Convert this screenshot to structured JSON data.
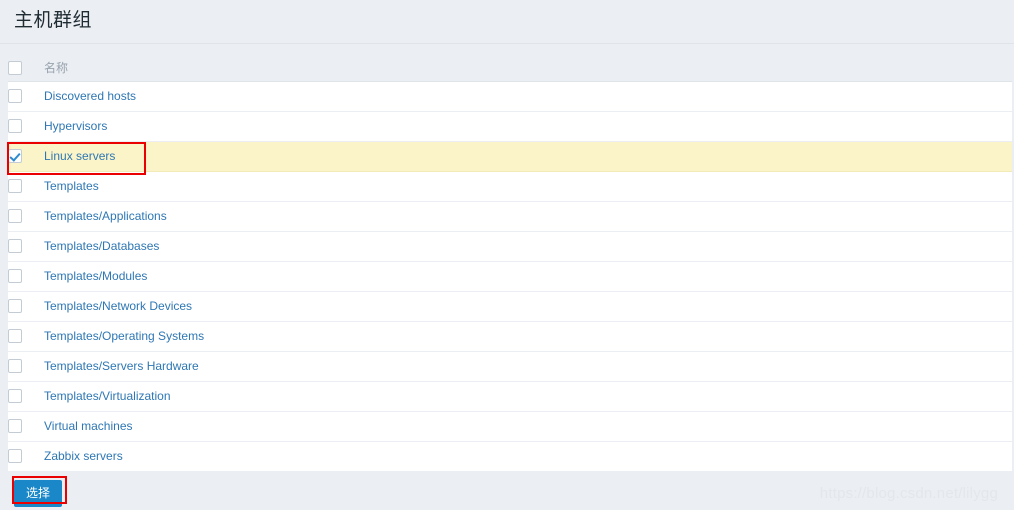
{
  "header": {
    "title": "主机群组"
  },
  "table": {
    "columns": [
      {
        "key": "checkbox",
        "label": ""
      },
      {
        "key": "name",
        "label": "名称"
      }
    ],
    "header_checkbox_checked": false,
    "rows": [
      {
        "name": "Discovered hosts",
        "checked": false
      },
      {
        "name": "Hypervisors",
        "checked": false
      },
      {
        "name": "Linux servers",
        "checked": true
      },
      {
        "name": "Templates",
        "checked": false
      },
      {
        "name": "Templates/Applications",
        "checked": false
      },
      {
        "name": "Templates/Databases",
        "checked": false
      },
      {
        "name": "Templates/Modules",
        "checked": false
      },
      {
        "name": "Templates/Network Devices",
        "checked": false
      },
      {
        "name": "Templates/Operating Systems",
        "checked": false
      },
      {
        "name": "Templates/Servers Hardware",
        "checked": false
      },
      {
        "name": "Templates/Virtualization",
        "checked": false
      },
      {
        "name": "Virtual machines",
        "checked": false
      },
      {
        "name": "Zabbix servers",
        "checked": false
      }
    ]
  },
  "footer": {
    "select_button_label": "选择"
  },
  "watermark": {
    "text": "https://blog.csdn.net/lilygg"
  },
  "colors": {
    "page_background": "#ebeef2",
    "table_background": "#ffffff",
    "link": "#2e77b4",
    "selected_row": "#fbf4c8",
    "button": "#1a87c8",
    "annotation": "#ea0000",
    "header_text": "#97a3ad"
  }
}
